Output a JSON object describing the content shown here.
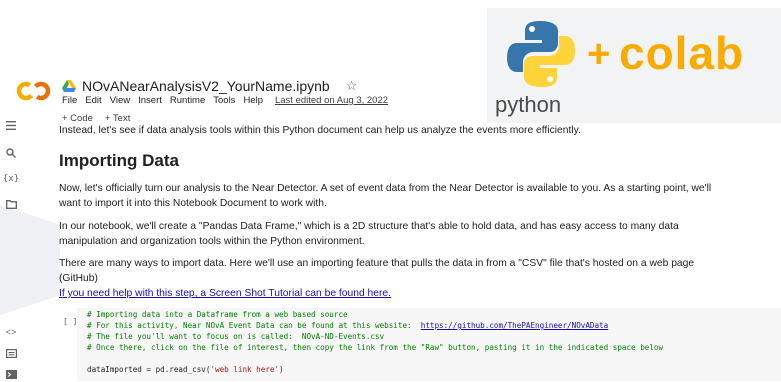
{
  "header": {
    "title": "NOvANearAnalysisV2_YourName.ipynb",
    "logo": "CO",
    "menu": [
      "File",
      "Edit",
      "View",
      "Insert",
      "Runtime",
      "Tools",
      "Help"
    ],
    "last_edited": "Last edited on Aug 3, 2022"
  },
  "toolbar": {
    "code": "+ Code",
    "text": "+ Text"
  },
  "banner": {
    "plus": "+",
    "colab": "colab",
    "python": "python"
  },
  "sidebar": {
    "icons": [
      "menu-icon",
      "search-icon",
      "variables-icon",
      "folder-icon",
      "code-snippets-icon",
      "command-palette-icon",
      "terminal-icon"
    ],
    "variables_label": "{x}"
  },
  "content": {
    "intro": "Instead, let's see if data analysis tools within this Python document can help us analyze the events more efficiently.",
    "heading": "Importing Data",
    "p1_line1": "Now, let's officially turn our analysis to the Near Detector. A set of event data from the Near Detector is available to you. As a starting point, we'll",
    "p1_line2": "want to import it into this Notebook Document to work with.",
    "p2_line1": "In our notebook, we'll create a \"Pandas Data Frame,\" which is a 2D structure that's able to hold data, and has easy access to many data",
    "p2_line2": "manipulation and organization tools within the Python environment.",
    "p3_line1": "There are many ways to import data. Here we'll use an importing feature that pulls the data in from a \"CSV\" file that's hosted on a web page",
    "p3_line2": "(GitHub)",
    "help_link": "If you need help with this step, a Screen Shot Tutorial can be found here."
  },
  "code": {
    "run_bracket": "[ ]",
    "line1": "# Importing data into a Dataframe from a web based source",
    "line2_prefix": "# For this activity, Near NOvA Event Data can be found at this website:  ",
    "line2_link": "https://github.com/ThePAEngineer/NOvAData",
    "line3": "# The file you'll want to focus on is called:  NOvA-ND-Events.csv",
    "line4": "# Once there, click on the file of interest, then copy the link from the \"Raw\" button, pasting it in the indicated space below",
    "line5_prefix": "dataImported = pd.read_csv(",
    "line5_string": "'web link here'",
    "line5_suffix": ")"
  },
  "colors": {
    "colab_orange": "#f9ab00",
    "python_blue": "#3776ab",
    "python_yellow": "#ffd43b",
    "link_blue": "#1a0dab",
    "comment_green": "#008000"
  }
}
